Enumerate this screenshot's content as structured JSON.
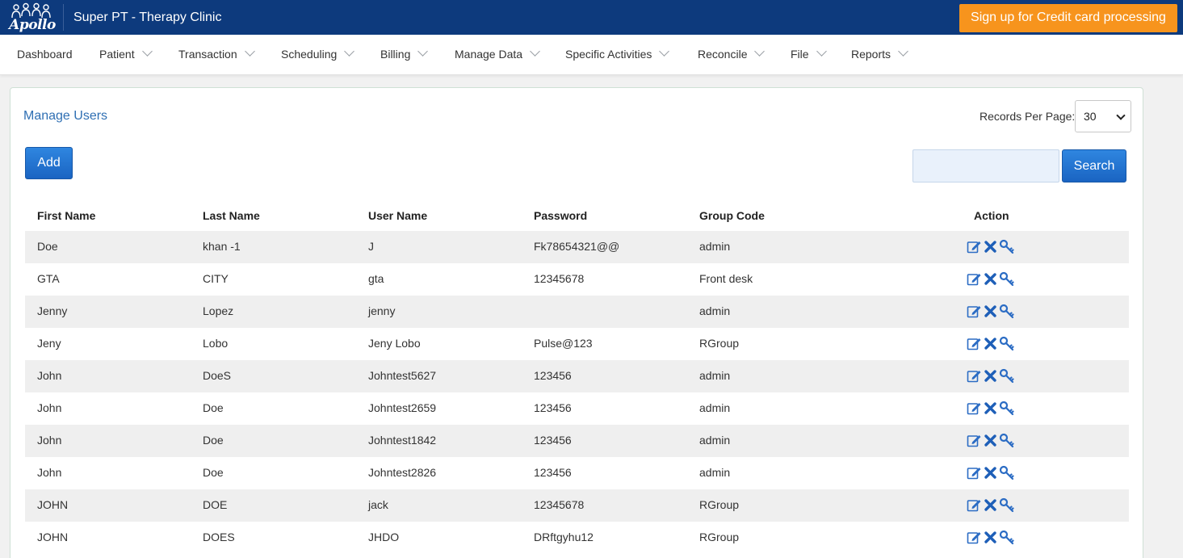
{
  "header": {
    "logo_text": "Apollo",
    "app_title": "Super PT - Therapy Clinic",
    "signup_label": "Sign up for Credit card processing",
    "colors": {
      "topbar": "#0d3a7d",
      "signup": "#f7941d",
      "primary_button": "#1a64c2",
      "title_link": "#2f6fb3"
    }
  },
  "nav": {
    "items": [
      {
        "label": "Dashboard",
        "has_dropdown": false
      },
      {
        "label": "Patient",
        "has_dropdown": true
      },
      {
        "label": "Transaction",
        "has_dropdown": true
      },
      {
        "label": "Scheduling",
        "has_dropdown": true
      },
      {
        "label": "Billing",
        "has_dropdown": true
      },
      {
        "label": "Manage Data",
        "has_dropdown": true
      },
      {
        "label": "Specific Activities",
        "has_dropdown": true
      },
      {
        "label": "Reconcile",
        "has_dropdown": true
      },
      {
        "label": "File",
        "has_dropdown": true
      },
      {
        "label": "Reports",
        "has_dropdown": true
      }
    ]
  },
  "panel": {
    "title": "Manage Users",
    "records_per_page_label": "Records Per Page:",
    "records_per_page_value": "30",
    "add_label": "Add",
    "search_value": "",
    "search_label": "Search"
  },
  "table": {
    "columns": [
      "First Name",
      "Last Name",
      "User Name",
      "Password",
      "Group Code",
      "Action"
    ],
    "rows": [
      [
        "Doe",
        "khan -1",
        "J",
        "Fk78654321@@",
        "admin"
      ],
      [
        "GTA",
        "CITY",
        "gta",
        "12345678",
        "Front desk"
      ],
      [
        "Jenny",
        "Lopez",
        "jenny",
        "",
        "admin"
      ],
      [
        "Jeny",
        "Lobo",
        "Jeny Lobo",
        "Pulse@123",
        "RGroup"
      ],
      [
        "John",
        "DoeS",
        "Johntest5627",
        "123456",
        "admin"
      ],
      [
        "John",
        "Doe",
        "Johntest2659",
        "123456",
        "admin"
      ],
      [
        "John",
        "Doe",
        "Johntest1842",
        "123456",
        "admin"
      ],
      [
        "John",
        "Doe",
        "Johntest2826",
        "123456",
        "admin"
      ],
      [
        "JOHN",
        "DOE",
        "jack",
        "12345678",
        "RGroup"
      ],
      [
        "JOHN",
        "DOES",
        "JHDO",
        "DRftgyhu12",
        "RGroup"
      ]
    ],
    "row_actions": [
      "edit-icon",
      "delete-icon",
      "key-icon"
    ]
  }
}
